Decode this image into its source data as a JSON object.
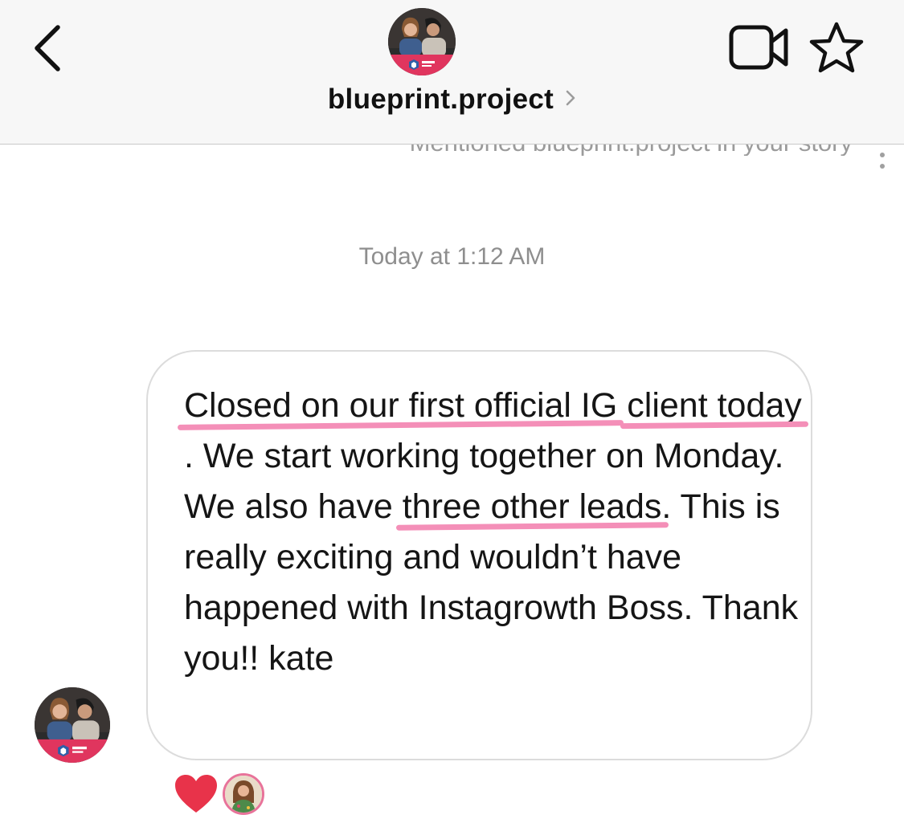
{
  "header": {
    "username": "blueprint.project",
    "icons": {
      "back": "chevron-left-icon",
      "video": "video-camera-icon",
      "star": "star-icon",
      "title_chevron": "chevron-right-icon"
    }
  },
  "conversation": {
    "previous_line": "Mentioned blueprint.project in your story",
    "timestamp": "Today at 1:12 AM",
    "message": {
      "segments": [
        {
          "text": "Closed on our first official IG",
          "highlight": true
        },
        {
          "text": " ",
          "highlight": false
        },
        {
          "text": "client today",
          "highlight": true
        },
        {
          "text": ". We start working together on Monday. We also have ",
          "highlight": false
        },
        {
          "text": "three other leads",
          "highlight": true
        },
        {
          "text": ". This is really exciting and wouldn’t have happened with Instagrowth Boss. Thank you!! kate",
          "highlight": false
        }
      ]
    },
    "reactions": [
      {
        "icon": "heart-icon",
        "color": "#e8334a"
      },
      {
        "icon": "reactor-avatar"
      }
    ]
  },
  "colors": {
    "highlight": "#f48fb8",
    "avatar_banner": "#e0355e",
    "header_bg": "#f7f7f7"
  },
  "avatar_logo_text": "blueprint project"
}
